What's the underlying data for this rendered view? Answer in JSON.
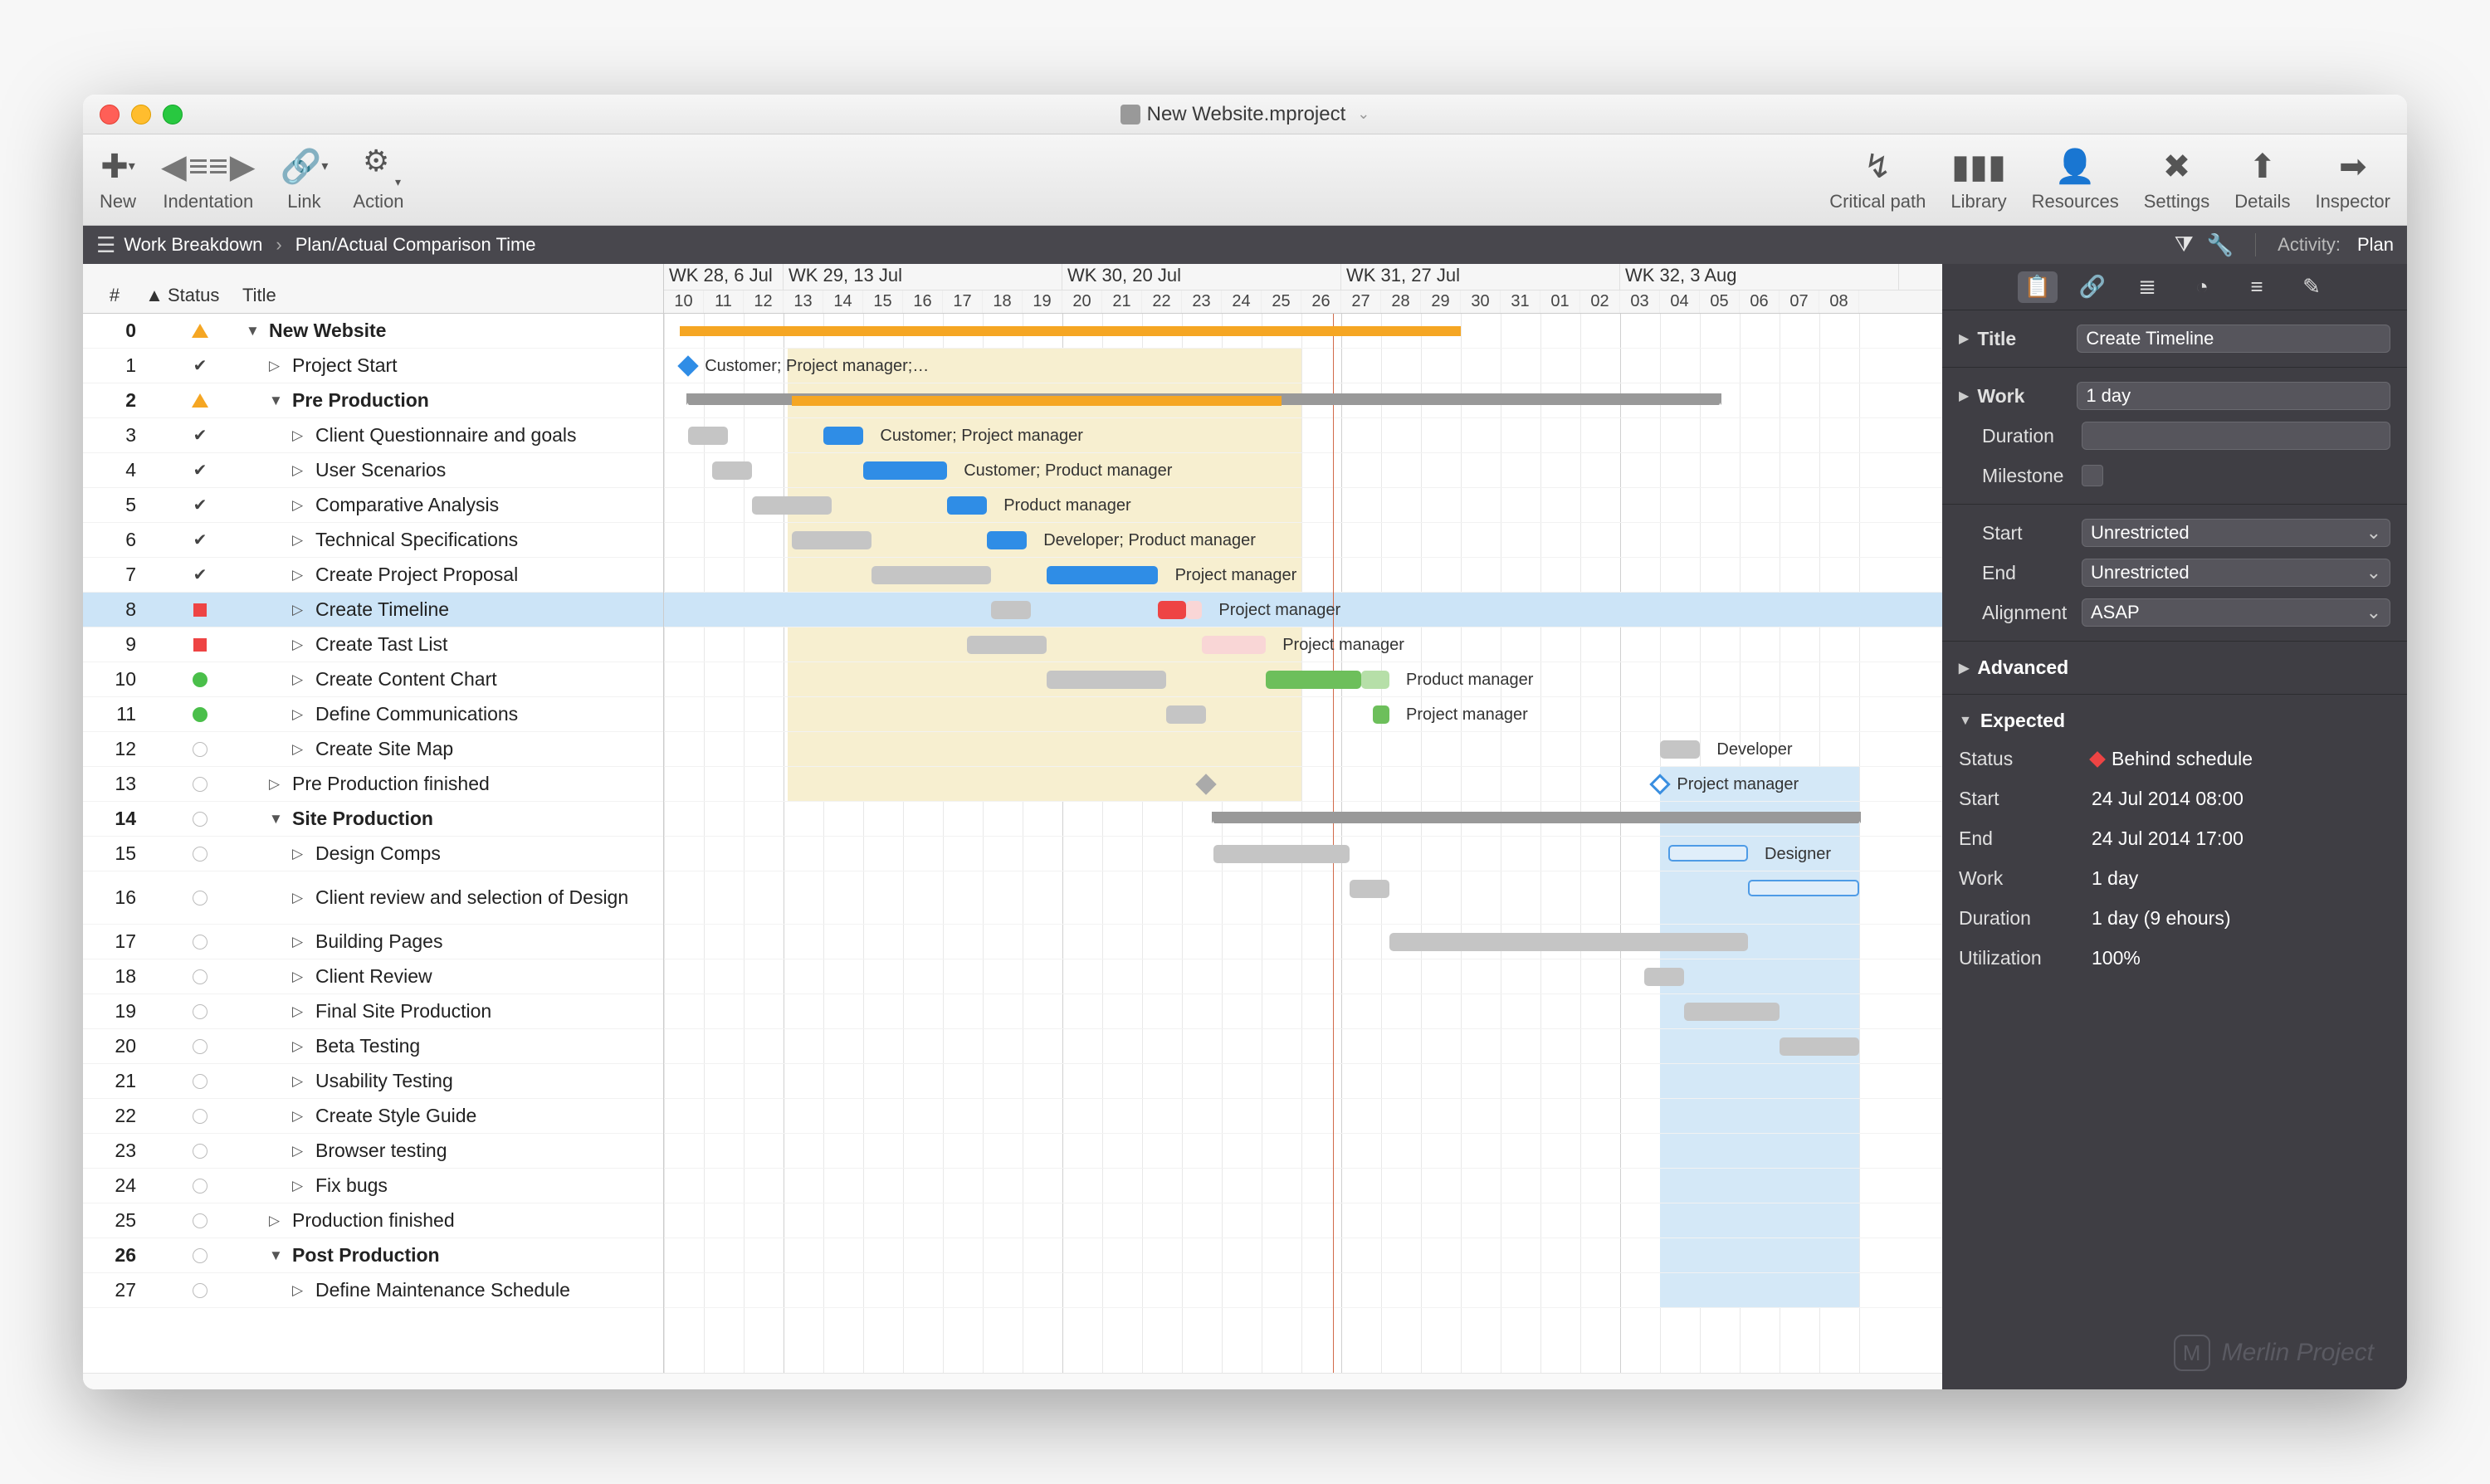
{
  "window": {
    "title": "New Website.mproject"
  },
  "toolbar": {
    "left": [
      {
        "id": "new",
        "label": "New"
      },
      {
        "id": "indentation",
        "label": "Indentation"
      },
      {
        "id": "link",
        "label": "Link"
      },
      {
        "id": "action",
        "label": "Action"
      }
    ],
    "right": [
      {
        "id": "criticalpath",
        "label": "Critical path"
      },
      {
        "id": "library",
        "label": "Library"
      },
      {
        "id": "resources",
        "label": "Resources"
      },
      {
        "id": "settings",
        "label": "Settings"
      },
      {
        "id": "details",
        "label": "Details"
      },
      {
        "id": "inspector",
        "label": "Inspector"
      }
    ]
  },
  "breadcrumb": {
    "root": "Work Breakdown",
    "view": "Plan/Actual Comparison Time"
  },
  "activity_kind": {
    "label": "Activity:",
    "value": "Plan"
  },
  "columns": {
    "number": "#",
    "sort": "▲",
    "status": "Status",
    "title": "Title"
  },
  "weeks": [
    "WK 28, 6 Jul",
    "WK 29, 13 Jul",
    "WK 30, 20 Jul",
    "WK 31, 27 Jul",
    "WK 32, 3 Aug"
  ],
  "days": [
    "10",
    "11",
    "12",
    "13",
    "14",
    "15",
    "16",
    "17",
    "18",
    "19",
    "20",
    "21",
    "22",
    "23",
    "24",
    "25",
    "26",
    "27",
    "28",
    "29",
    "30",
    "31",
    "01",
    "02",
    "03",
    "04",
    "05",
    "06",
    "07",
    "08"
  ],
  "tasks": [
    {
      "n": 0,
      "status": "warn",
      "indent": 0,
      "exp": "▼",
      "title": "New Website",
      "bold": true
    },
    {
      "n": 1,
      "status": "done",
      "indent": 1,
      "exp": "▷",
      "title": "Project Start"
    },
    {
      "n": 2,
      "status": "warn",
      "indent": 1,
      "exp": "▼",
      "title": "Pre Production",
      "bold": true
    },
    {
      "n": 3,
      "status": "done",
      "indent": 2,
      "exp": "▷",
      "title": "Client Questionnaire and goals"
    },
    {
      "n": 4,
      "status": "done",
      "indent": 2,
      "exp": "▷",
      "title": "User Scenarios"
    },
    {
      "n": 5,
      "status": "done",
      "indent": 2,
      "exp": "▷",
      "title": "Comparative Analysis"
    },
    {
      "n": 6,
      "status": "done",
      "indent": 2,
      "exp": "▷",
      "title": "Technical Specifications"
    },
    {
      "n": 7,
      "status": "done",
      "indent": 2,
      "exp": "▷",
      "title": "Create Project Proposal"
    },
    {
      "n": 8,
      "status": "behind",
      "indent": 2,
      "exp": "▷",
      "title": "Create Timeline",
      "selected": true
    },
    {
      "n": 9,
      "status": "behind",
      "indent": 2,
      "exp": "▷",
      "title": "Create Tast List"
    },
    {
      "n": 10,
      "status": "ok",
      "indent": 2,
      "exp": "▷",
      "title": "Create Content Chart"
    },
    {
      "n": 11,
      "status": "ok",
      "indent": 2,
      "exp": "▷",
      "title": "Define Communications"
    },
    {
      "n": 12,
      "status": "none",
      "indent": 2,
      "exp": "▷",
      "title": "Create Site Map"
    },
    {
      "n": 13,
      "status": "none",
      "indent": 1,
      "exp": "▷",
      "title": "Pre Production finished"
    },
    {
      "n": 14,
      "status": "none",
      "indent": 1,
      "exp": "▼",
      "title": "Site Production",
      "bold": true
    },
    {
      "n": 15,
      "status": "none",
      "indent": 2,
      "exp": "▷",
      "title": "Design Comps"
    },
    {
      "n": 16,
      "status": "none",
      "indent": 2,
      "exp": "▷",
      "title": "Client review and selection of Design",
      "tall": true
    },
    {
      "n": 17,
      "status": "none",
      "indent": 2,
      "exp": "▷",
      "title": "Building Pages"
    },
    {
      "n": 18,
      "status": "none",
      "indent": 2,
      "exp": "▷",
      "title": "Client Review"
    },
    {
      "n": 19,
      "status": "none",
      "indent": 2,
      "exp": "▷",
      "title": "Final Site Production"
    },
    {
      "n": 20,
      "status": "none",
      "indent": 2,
      "exp": "▷",
      "title": "Beta Testing"
    },
    {
      "n": 21,
      "status": "none",
      "indent": 2,
      "exp": "▷",
      "title": "Usability Testing"
    },
    {
      "n": 22,
      "status": "none",
      "indent": 2,
      "exp": "▷",
      "title": "Create Style Guide"
    },
    {
      "n": 23,
      "status": "none",
      "indent": 2,
      "exp": "▷",
      "title": "Browser testing"
    },
    {
      "n": 24,
      "status": "none",
      "indent": 2,
      "exp": "▷",
      "title": "Fix bugs"
    },
    {
      "n": 25,
      "status": "none",
      "indent": 1,
      "exp": "▷",
      "title": "Production finished"
    },
    {
      "n": 26,
      "status": "none",
      "indent": 1,
      "exp": "▼",
      "title": "Post Production",
      "bold": true
    },
    {
      "n": 27,
      "status": "none",
      "indent": 2,
      "exp": "▷",
      "title": "Define Maintenance Schedule"
    }
  ],
  "chart_data": {
    "type": "gantt",
    "unit": "day",
    "day_width": 48,
    "origin": "10",
    "row_labels": {
      "1": "Customer; Project manager;…",
      "3": "Customer; Project manager",
      "4": "Customer; Product manager",
      "5": "Product manager",
      "6": "Developer; Product manager",
      "7": "Project manager",
      "8": "Project manager",
      "9": "Project manager",
      "10": "Product manager",
      "11": "Project manager",
      "12": "Developer",
      "13": "Project manager",
      "15": "Designer"
    },
    "bars": [
      {
        "row": 0,
        "kind": "orange",
        "from": 0.4,
        "to": 20.0
      },
      {
        "row": 1,
        "kind": "milestone",
        "left": 0.6
      },
      {
        "row": 2,
        "kind": "sum",
        "from": 0.6,
        "to": 26.5
      },
      {
        "row": 2,
        "kind": "orange",
        "from": 3.2,
        "to": 15.5
      },
      {
        "row": 3,
        "kind": "gray",
        "from": 0.6,
        "to": 1.6
      },
      {
        "row": 3,
        "kind": "blue",
        "from": 4.0,
        "to": 5.0
      },
      {
        "row": 4,
        "kind": "gray",
        "from": 1.2,
        "to": 2.2
      },
      {
        "row": 4,
        "kind": "blue",
        "from": 5.0,
        "to": 7.1
      },
      {
        "row": 5,
        "kind": "gray",
        "from": 2.2,
        "to": 4.2
      },
      {
        "row": 5,
        "kind": "blue",
        "from": 7.1,
        "to": 8.1
      },
      {
        "row": 6,
        "kind": "gray",
        "from": 3.2,
        "to": 5.2
      },
      {
        "row": 6,
        "kind": "blue",
        "from": 8.1,
        "to": 9.1
      },
      {
        "row": 7,
        "kind": "gray",
        "from": 5.2,
        "to": 8.2
      },
      {
        "row": 7,
        "kind": "blue",
        "from": 9.6,
        "to": 12.4
      },
      {
        "row": 8,
        "kind": "gray",
        "from": 8.2,
        "to": 9.2
      },
      {
        "row": 8,
        "kind": "red",
        "from": 12.4,
        "to": 13.1
      },
      {
        "row": 8,
        "kind": "pink",
        "from": 13.1,
        "to": 13.5
      },
      {
        "row": 9,
        "kind": "gray",
        "from": 7.6,
        "to": 9.6
      },
      {
        "row": 9,
        "kind": "pink",
        "from": 13.5,
        "to": 15.1
      },
      {
        "row": 10,
        "kind": "gray",
        "from": 9.6,
        "to": 12.6
      },
      {
        "row": 10,
        "kind": "green",
        "from": 15.1,
        "to": 17.5
      },
      {
        "row": 10,
        "kind": "green2",
        "from": 17.5,
        "to": 18.2
      },
      {
        "row": 11,
        "kind": "gray",
        "from": 12.6,
        "to": 13.6
      },
      {
        "row": 11,
        "kind": "green",
        "from": 17.8,
        "to": 18.2
      },
      {
        "row": 12,
        "kind": "gray",
        "from": 25.0,
        "to": 26.0
      },
      {
        "row": 13,
        "kind": "milestone_gray",
        "left": 13.6
      },
      {
        "row": 13,
        "kind": "milestone_out",
        "left": 25.0
      },
      {
        "row": 14,
        "kind": "sum",
        "from": 13.8,
        "to": 30
      },
      {
        "row": 15,
        "kind": "gray",
        "from": 13.8,
        "to": 17.2
      },
      {
        "row": 15,
        "kind": "outline",
        "from": 25.2,
        "to": 27.2
      },
      {
        "row": 16,
        "kind": "gray",
        "from": 17.2,
        "to": 18.2
      },
      {
        "row": 16,
        "kind": "outline",
        "from": 27.2,
        "to": 30
      },
      {
        "row": 17,
        "kind": "gray",
        "from": 18.2,
        "to": 27.2
      },
      {
        "row": 18,
        "kind": "gray",
        "from": 24.6,
        "to": 25.6
      },
      {
        "row": 19,
        "kind": "gray",
        "from": 25.6,
        "to": 28.0
      },
      {
        "row": 20,
        "kind": "gray",
        "from": 28.0,
        "to": 30
      }
    ],
    "shade": [
      {
        "from": 3.1,
        "to": 16.0,
        "cls": "planbg",
        "rows": [
          1,
          13
        ]
      },
      {
        "from": 25.0,
        "to": 30,
        "cls": "planbg b2",
        "rows": [
          13,
          27
        ]
      }
    ],
    "redline": 16.8
  },
  "inspector": {
    "title_field": {
      "label": "Title",
      "value": "Create Timeline"
    },
    "work": {
      "label": "Work",
      "value": "1 day"
    },
    "duration": {
      "label": "Duration",
      "value": ""
    },
    "milestone": {
      "label": "Milestone"
    },
    "start": {
      "label": "Start",
      "value": "Unrestricted"
    },
    "end": {
      "label": "End",
      "value": "Unrestricted"
    },
    "alignment": {
      "label": "Alignment",
      "value": "ASAP"
    },
    "advanced": "Advanced",
    "expected": {
      "header": "Expected",
      "status": {
        "label": "Status",
        "value": "Behind schedule"
      },
      "start": {
        "label": "Start",
        "value": "24 Jul 2014 08:00"
      },
      "end": {
        "label": "End",
        "value": "24 Jul 2014 17:00"
      },
      "work": {
        "label": "Work",
        "value": "1 day"
      },
      "duration": {
        "label": "Duration",
        "value": "1 day (9 ehours)"
      },
      "utilization": {
        "label": "Utilization",
        "value": "100%"
      }
    }
  },
  "watermark": "Merlin Project"
}
